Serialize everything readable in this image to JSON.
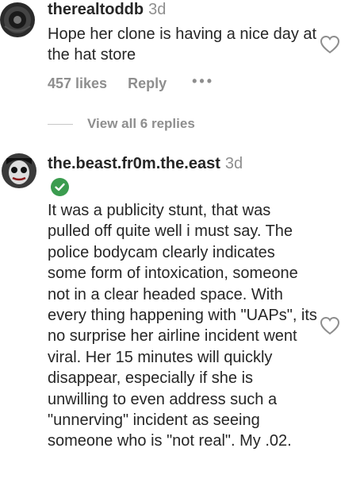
{
  "comments": [
    {
      "username": "therealtoddb",
      "time": "3d",
      "text": "Hope her clone is having a nice day at the hat store",
      "likes": "457 likes",
      "reply_label": "Reply",
      "more_label": "•••",
      "view_replies": "View all 6 replies",
      "avatar_icon": "avatar-image",
      "like_icon": "heart-outline-icon"
    },
    {
      "username": "the.beast.fr0m.the.east",
      "time": "3d",
      "verified": true,
      "text": "It was a publicity stunt, that was pulled off quite well i must say. The police bodycam clearly indicates some form of intoxication, someone not in a clear headed space. With every thing happening with \"UAPs\", its no surprise her airline incident went viral. Her 15 minutes will quickly disappear, especially if she is unwilling to even address such a \"unnerving\" incident as seeing someone who is \"not real\". My .02.",
      "avatar_icon": "avatar-image",
      "like_icon": "heart-outline-icon",
      "verified_icon": "verified-check-icon"
    }
  ],
  "colors": {
    "text": "#262626",
    "secondary": "#8e8e8e",
    "verified": "#3b9c4f"
  }
}
